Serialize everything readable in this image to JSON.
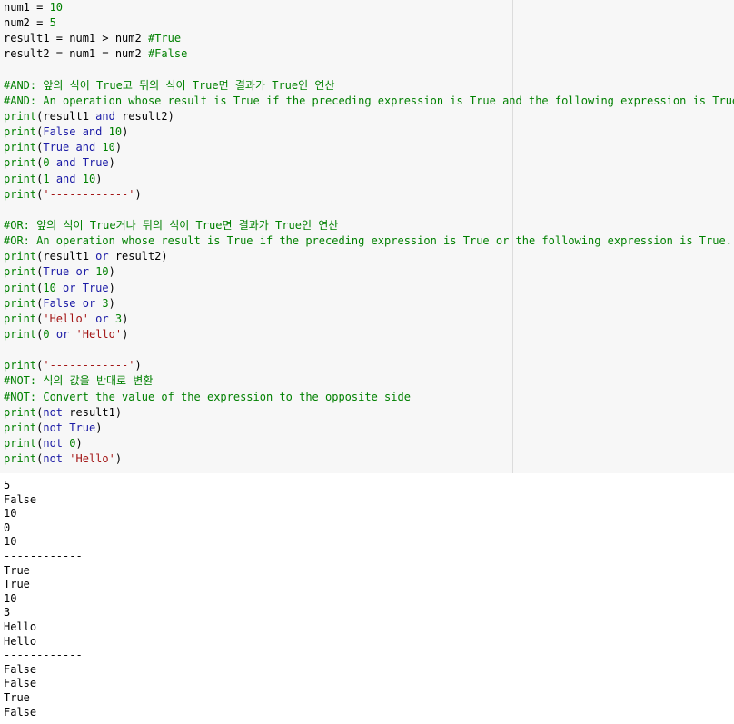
{
  "colors": {
    "code_background": "#f7f7f7",
    "builtin": "#008000",
    "number": "#008000",
    "keyword": "#1a1aa6",
    "string": "#a31515",
    "comment": "#008000",
    "plain": "#000000"
  },
  "code_lines": [
    [
      [
        "plain",
        "num1 = "
      ],
      [
        "number",
        "10"
      ]
    ],
    [
      [
        "plain",
        "num2 = "
      ],
      [
        "number",
        "5"
      ]
    ],
    [
      [
        "plain",
        "result1 = num1 > num2 "
      ],
      [
        "comment",
        "#True"
      ]
    ],
    [
      [
        "plain",
        "result2 = num1 = num2 "
      ],
      [
        "comment",
        "#False"
      ]
    ],
    [],
    [
      [
        "comment",
        "#AND: 앞의 식이 True고 뒤의 식이 True면 결과가 True인 연산"
      ]
    ],
    [
      [
        "comment",
        "#AND: An operation whose result is True if the preceding expression is True and the following expression is True."
      ]
    ],
    [
      [
        "builtin",
        "print"
      ],
      [
        "plain",
        "(result1 "
      ],
      [
        "keyword",
        "and"
      ],
      [
        "plain",
        " result2)"
      ]
    ],
    [
      [
        "builtin",
        "print"
      ],
      [
        "plain",
        "("
      ],
      [
        "keyword",
        "False"
      ],
      [
        "plain",
        " "
      ],
      [
        "keyword",
        "and"
      ],
      [
        "plain",
        " "
      ],
      [
        "number",
        "10"
      ],
      [
        "plain",
        ")"
      ]
    ],
    [
      [
        "builtin",
        "print"
      ],
      [
        "plain",
        "("
      ],
      [
        "keyword",
        "True"
      ],
      [
        "plain",
        " "
      ],
      [
        "keyword",
        "and"
      ],
      [
        "plain",
        " "
      ],
      [
        "number",
        "10"
      ],
      [
        "plain",
        ")"
      ]
    ],
    [
      [
        "builtin",
        "print"
      ],
      [
        "plain",
        "("
      ],
      [
        "number",
        "0"
      ],
      [
        "plain",
        " "
      ],
      [
        "keyword",
        "and"
      ],
      [
        "plain",
        " "
      ],
      [
        "keyword",
        "True"
      ],
      [
        "plain",
        ")"
      ]
    ],
    [
      [
        "builtin",
        "print"
      ],
      [
        "plain",
        "("
      ],
      [
        "number",
        "1"
      ],
      [
        "plain",
        " "
      ],
      [
        "keyword",
        "and"
      ],
      [
        "plain",
        " "
      ],
      [
        "number",
        "10"
      ],
      [
        "plain",
        ")"
      ]
    ],
    [
      [
        "builtin",
        "print"
      ],
      [
        "plain",
        "("
      ],
      [
        "string",
        "'------------'"
      ],
      [
        "plain",
        ")"
      ]
    ],
    [],
    [
      [
        "comment",
        "#OR: 앞의 식이 True거나 뒤의 식이 True면 결과가 True인 연산"
      ]
    ],
    [
      [
        "comment",
        "#OR: An operation whose result is True if the preceding expression is True or the following expression is True."
      ]
    ],
    [
      [
        "builtin",
        "print"
      ],
      [
        "plain",
        "(result1 "
      ],
      [
        "keyword",
        "or"
      ],
      [
        "plain",
        " result2)"
      ]
    ],
    [
      [
        "builtin",
        "print"
      ],
      [
        "plain",
        "("
      ],
      [
        "keyword",
        "True"
      ],
      [
        "plain",
        " "
      ],
      [
        "keyword",
        "or"
      ],
      [
        "plain",
        " "
      ],
      [
        "number",
        "10"
      ],
      [
        "plain",
        ")"
      ]
    ],
    [
      [
        "builtin",
        "print"
      ],
      [
        "plain",
        "("
      ],
      [
        "number",
        "10"
      ],
      [
        "plain",
        " "
      ],
      [
        "keyword",
        "or"
      ],
      [
        "plain",
        " "
      ],
      [
        "keyword",
        "True"
      ],
      [
        "plain",
        ")"
      ]
    ],
    [
      [
        "builtin",
        "print"
      ],
      [
        "plain",
        "("
      ],
      [
        "keyword",
        "False"
      ],
      [
        "plain",
        " "
      ],
      [
        "keyword",
        "or"
      ],
      [
        "plain",
        " "
      ],
      [
        "number",
        "3"
      ],
      [
        "plain",
        ")"
      ]
    ],
    [
      [
        "builtin",
        "print"
      ],
      [
        "plain",
        "("
      ],
      [
        "string",
        "'Hello'"
      ],
      [
        "plain",
        " "
      ],
      [
        "keyword",
        "or"
      ],
      [
        "plain",
        " "
      ],
      [
        "number",
        "3"
      ],
      [
        "plain",
        ")"
      ]
    ],
    [
      [
        "builtin",
        "print"
      ],
      [
        "plain",
        "("
      ],
      [
        "number",
        "0"
      ],
      [
        "plain",
        " "
      ],
      [
        "keyword",
        "or"
      ],
      [
        "plain",
        " "
      ],
      [
        "string",
        "'Hello'"
      ],
      [
        "plain",
        ")"
      ]
    ],
    [],
    [
      [
        "builtin",
        "print"
      ],
      [
        "plain",
        "("
      ],
      [
        "string",
        "'------------'"
      ],
      [
        "plain",
        ")"
      ]
    ],
    [
      [
        "comment",
        "#NOT: 식의 값을 반대로 변환"
      ]
    ],
    [
      [
        "comment",
        "#NOT: Convert the value of the expression to the opposite side"
      ]
    ],
    [
      [
        "builtin",
        "print"
      ],
      [
        "plain",
        "("
      ],
      [
        "keyword",
        "not"
      ],
      [
        "plain",
        " result1)"
      ]
    ],
    [
      [
        "builtin",
        "print"
      ],
      [
        "plain",
        "("
      ],
      [
        "keyword",
        "not"
      ],
      [
        "plain",
        " "
      ],
      [
        "keyword",
        "True"
      ],
      [
        "plain",
        ")"
      ]
    ],
    [
      [
        "builtin",
        "print"
      ],
      [
        "plain",
        "("
      ],
      [
        "keyword",
        "not"
      ],
      [
        "plain",
        " "
      ],
      [
        "number",
        "0"
      ],
      [
        "plain",
        ")"
      ]
    ],
    [
      [
        "builtin",
        "print"
      ],
      [
        "plain",
        "("
      ],
      [
        "keyword",
        "not"
      ],
      [
        "plain",
        " "
      ],
      [
        "string",
        "'Hello'"
      ],
      [
        "plain",
        ")"
      ]
    ]
  ],
  "output_lines": [
    "5",
    "False",
    "10",
    "0",
    "10",
    "------------",
    "True",
    "True",
    "10",
    "3",
    "Hello",
    "Hello",
    "------------",
    "False",
    "False",
    "True",
    "False"
  ]
}
